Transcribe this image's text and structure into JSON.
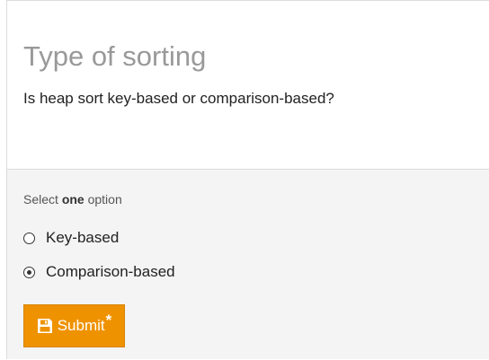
{
  "question": {
    "title": "Type of sorting",
    "text": "Is heap sort key-based or comparison-based?"
  },
  "answer": {
    "instruction_prefix": "Select ",
    "instruction_emphasis": "one",
    "instruction_suffix": " option",
    "options": [
      {
        "label": "Key-based",
        "selected": false
      },
      {
        "label": "Comparison-based",
        "selected": true
      }
    ]
  },
  "submit": {
    "label": "Submit",
    "marker": "*",
    "icon": "floppy-disk-icon",
    "color": "#ef9200"
  }
}
